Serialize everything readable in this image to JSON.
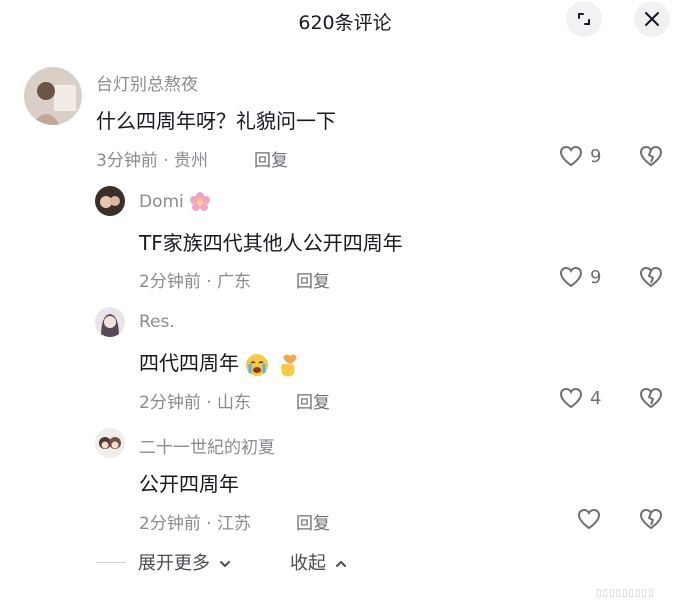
{
  "header": {
    "title": "620条评论",
    "expand_icon": "expand-corner-icon",
    "close_icon": "close-icon"
  },
  "comments": [
    {
      "username": "台灯别总熬夜",
      "content": "什么四周年呀？礼貌问一下",
      "meta": "3分钟前 · 贵州",
      "reply_label": "回复",
      "likes": "9"
    },
    {
      "username": "Domi",
      "content": "TF家族四代其他人公开四周年",
      "meta": "2分钟前 · 广东",
      "reply_label": "回复",
      "likes": "9",
      "emoji": "cherry-blossom"
    },
    {
      "username": "Res.",
      "content": "四代四周年",
      "meta": "2分钟前 · 山东",
      "reply_label": "回复",
      "likes": "4",
      "emojis": [
        "crying-face",
        "finger-heart"
      ]
    },
    {
      "username": "二十一世紀的初夏",
      "content": "公开四周年",
      "meta": "2分钟前 · 江苏",
      "reply_label": "回复",
      "likes": ""
    }
  ],
  "footer": {
    "expand_more": "展开更多",
    "collapse": "收起"
  },
  "watermark": "▯▯▯▯▯▯▯▯▯",
  "colors": {
    "text_primary": "#161823",
    "text_secondary": "#8a8b91",
    "button_bg": "#f2f2f4"
  }
}
